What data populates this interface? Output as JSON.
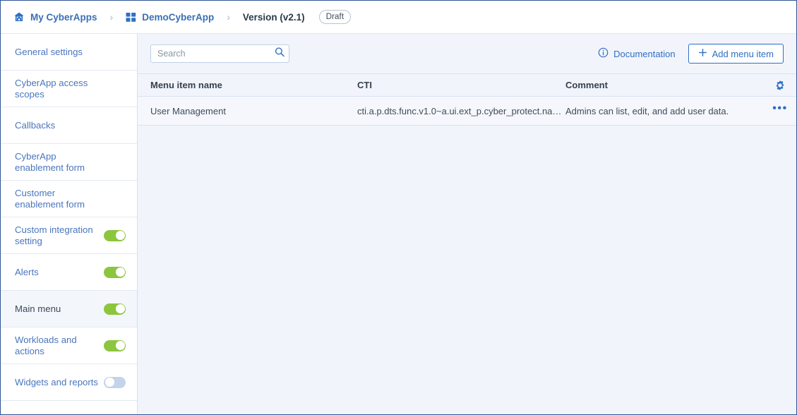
{
  "breadcrumb": {
    "home_label": "My CyberApps",
    "home_icon": "home-icon",
    "app_label": "DemoCyberApp",
    "app_icon": "grid-apps-icon",
    "separator": "›",
    "version_label": "Version (v2.1)",
    "status_badge": "Draft"
  },
  "sidebar": {
    "items": [
      {
        "label": "General settings",
        "toggle": null,
        "active": false
      },
      {
        "label": "CyberApp access scopes",
        "toggle": null,
        "active": false
      },
      {
        "label": "Callbacks",
        "toggle": null,
        "active": false
      },
      {
        "label": "CyberApp enablement form",
        "toggle": null,
        "active": false
      },
      {
        "label": "Customer enablement form",
        "toggle": null,
        "active": false
      },
      {
        "label": "Custom integration setting",
        "toggle": "on",
        "active": false
      },
      {
        "label": "Alerts",
        "toggle": "on",
        "active": false
      },
      {
        "label": "Main menu",
        "toggle": "on",
        "active": true
      },
      {
        "label": "Workloads and actions",
        "toggle": "on",
        "active": false
      },
      {
        "label": "Widgets and reports",
        "toggle": "off",
        "active": false
      }
    ]
  },
  "toolbar": {
    "search_placeholder": "Search",
    "search_value": "",
    "search_icon": "search-icon",
    "documentation_label": "Documentation",
    "documentation_icon": "info-circle-icon",
    "add_button_label": "Add menu item",
    "add_button_icon": "plus-icon",
    "settings_icon": "gear-icon"
  },
  "table": {
    "columns": [
      "Menu item name",
      "CTI",
      "Comment"
    ],
    "rows": [
      {
        "name": "User Management",
        "cti": "cti.a.p.dts.func.v1.0~a.ui.ext_p.cyber_protect.na…",
        "comment": "Admins can list, edit, and add user data.",
        "row_menu_icon": "ellipsis-icon"
      }
    ]
  },
  "colors": {
    "link_blue": "#2f6fc4",
    "sidebar_link": "#4a76bd",
    "toggle_on": "#8cc63e",
    "toggle_off": "#c3d3ea",
    "page_bg": "#f1f4fa",
    "row_bg": "#f5f7fc",
    "border": "#dbe4f2"
  }
}
